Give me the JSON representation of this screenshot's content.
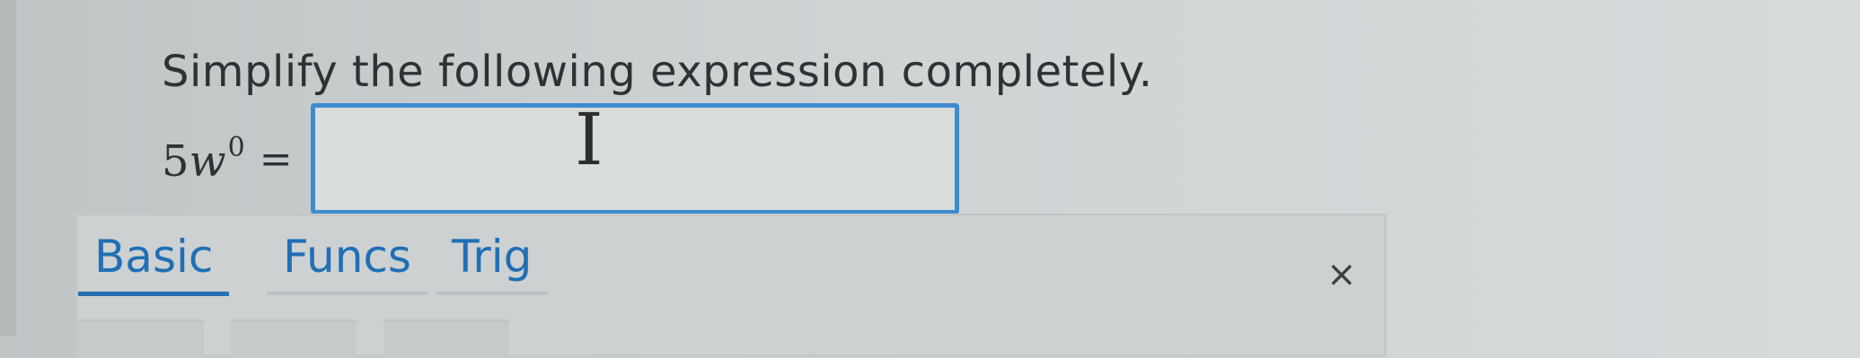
{
  "question": {
    "prompt": "Simplify the following expression completely."
  },
  "expression": {
    "coefficient": "5",
    "variable": "w",
    "exponent": "0",
    "equals": "="
  },
  "answer_input": {
    "value": ""
  },
  "keyboard": {
    "tabs": [
      {
        "label": "Basic",
        "active": true
      },
      {
        "label": "Funcs",
        "active": false
      },
      {
        "label": "Trig",
        "active": false
      }
    ],
    "close_label": "×"
  },
  "colors": {
    "accent": "#3c8ccf",
    "tab_text": "#1f6fb5"
  },
  "icons": {
    "cursor": "text-cursor-icon",
    "close": "close-icon"
  }
}
